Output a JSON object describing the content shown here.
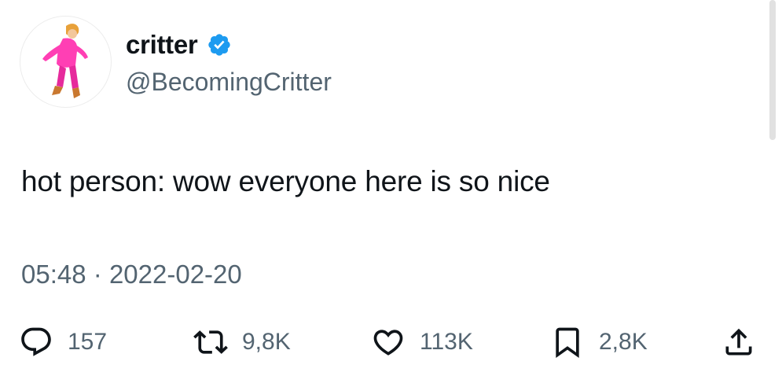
{
  "author": {
    "display_name": "critter",
    "handle": "@BecomingCritter",
    "verified": true
  },
  "tweet": {
    "text": "hot person: wow everyone here is so nice",
    "time": "05:48",
    "separator": "·",
    "date": "2022-02-20"
  },
  "actions": {
    "replies": "157",
    "retweets": "9,8K",
    "likes": "113K",
    "bookmarks": "2,8K"
  },
  "colors": {
    "text_primary": "#0f1419",
    "text_secondary": "#536471",
    "verified_badge": "#1d9bf0",
    "avatar_outfit": "#ff3fb4"
  },
  "icons": {
    "reply": "reply-icon",
    "retweet": "retweet-icon",
    "like": "heart-icon",
    "bookmark": "bookmark-icon",
    "share": "share-icon",
    "verified": "verified-badge-icon"
  }
}
